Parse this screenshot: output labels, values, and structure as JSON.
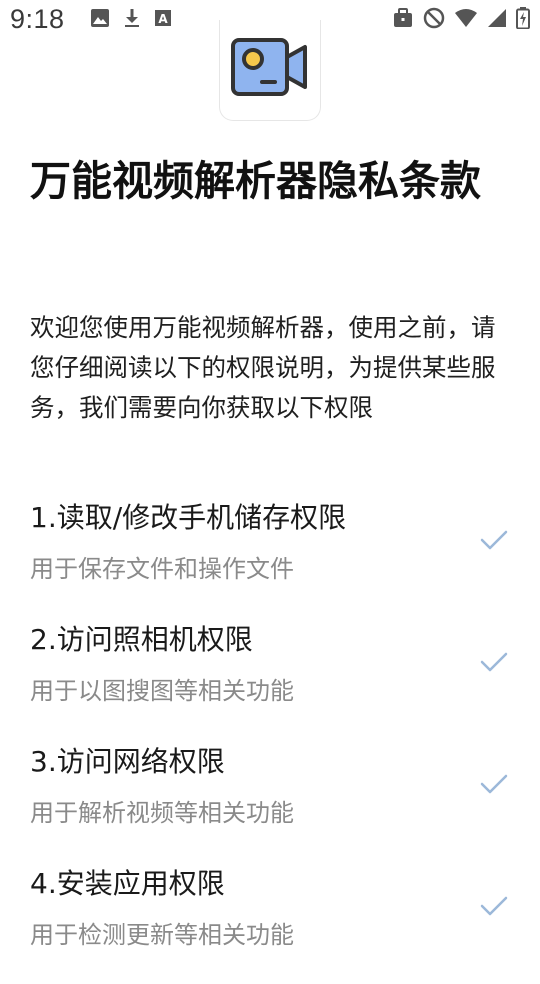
{
  "status_bar": {
    "time": "9:18",
    "left_icons": [
      "image-icon",
      "download-icon",
      "font-icon"
    ],
    "right_icons": [
      "briefcase-icon",
      "no-signal-icon",
      "wifi-icon",
      "signal-icon",
      "battery-icon"
    ]
  },
  "app": {
    "logo_icon": "video-camera-icon"
  },
  "page": {
    "title": "万能视频解析器隐私条款",
    "intro": "欢迎您使用万能视频解析器，使用之前，请您仔细阅读以下的权限说明，为提供某些服务，我们需要向你获取以下权限"
  },
  "permissions": [
    {
      "title": "1.读取/修改手机储存权限",
      "desc": "用于保存文件和操作文件",
      "checked": true
    },
    {
      "title": "2.访问照相机权限",
      "desc": "用于以图搜图等相关功能",
      "checked": true
    },
    {
      "title": "3.访问网络权限",
      "desc": "用于解析视频等相关功能",
      "checked": true
    },
    {
      "title": "4.安装应用权限",
      "desc": "用于检测更新等相关功能",
      "checked": true
    }
  ],
  "colors": {
    "check": "#9cb8d9",
    "logo_fill": "#8fb4ef",
    "logo_lens": "#f6c84c",
    "logo_stroke": "#333333"
  }
}
